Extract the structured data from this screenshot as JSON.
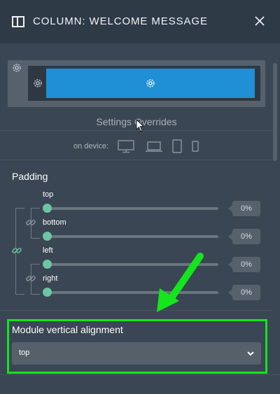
{
  "header": {
    "title": "COLUMN: WELCOME MESSAGE",
    "icon": "panel-columns-icon",
    "close_icon": "close-icon"
  },
  "preview": {
    "settings_overrides": "Settings Overrides",
    "button_color": "#1f8fd6"
  },
  "device": {
    "label": "on device:",
    "icons": [
      "desktop-icon",
      "laptop-icon",
      "tablet-icon",
      "phone-icon"
    ]
  },
  "padding": {
    "title": "Padding",
    "sliders": [
      {
        "label": "top",
        "value": "0%"
      },
      {
        "label": "bottom",
        "value": "0%"
      },
      {
        "label": "left",
        "value": "0%"
      },
      {
        "label": "right",
        "value": "0%"
      }
    ],
    "accent": "#6cc5a4"
  },
  "alignment": {
    "title": "Module vertical alignment",
    "selected": "top"
  },
  "annotation": {
    "highlight_color": "#14e51c"
  }
}
